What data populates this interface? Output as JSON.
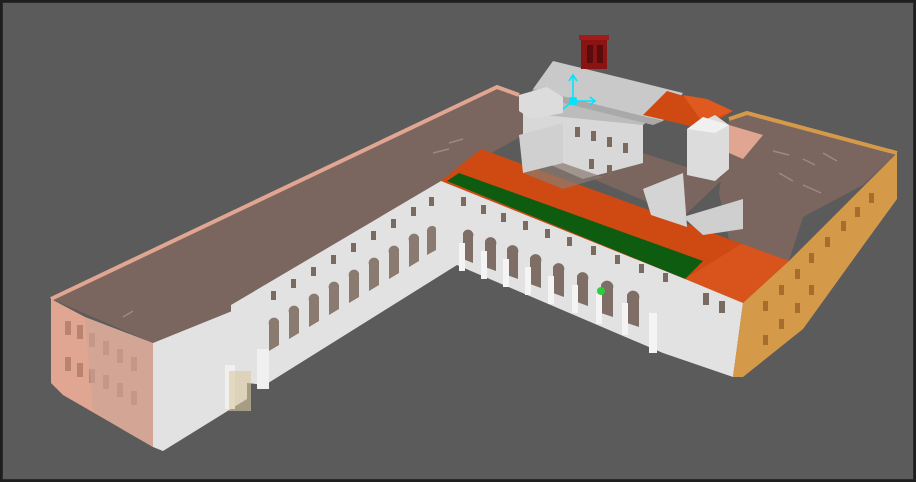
{
  "viewport": {
    "background": "#5b5b5b",
    "gizmo_color": "#00e5ff"
  },
  "model": {
    "colors": {
      "roof_flat": "#7a665e",
      "roof_tile": "#cf4a12",
      "roof_green": "#0d5c10",
      "wall_white": "#e2e2e2",
      "wall_shadow": "#c9c9c9",
      "wall_pink": "#e0a692",
      "wall_ochre": "#d49a4a",
      "bell_tower": "#8a1414",
      "window_brown": "#7a6a60"
    }
  }
}
